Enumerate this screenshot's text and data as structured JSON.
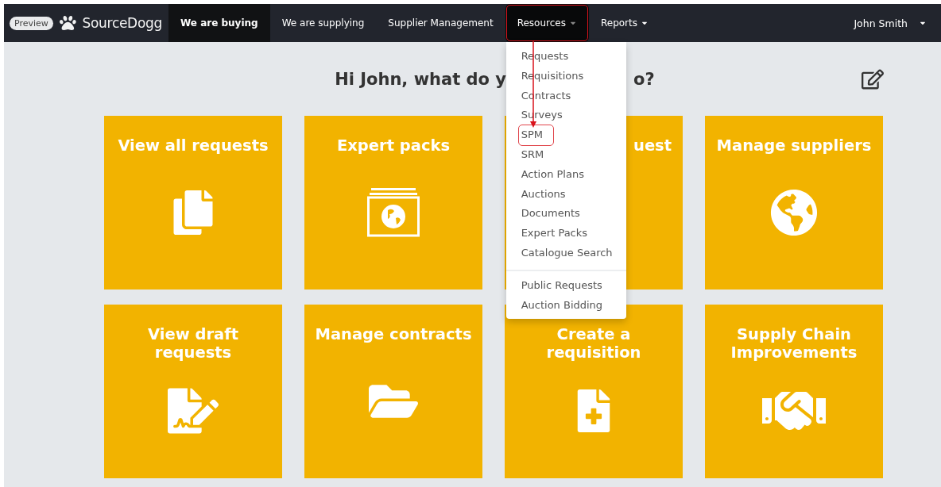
{
  "nav": {
    "badge": "Preview",
    "brand": "SourceDogg",
    "items": [
      {
        "label": "We are buying",
        "selected": true,
        "open": false,
        "dropdown": false,
        "annotated": false
      },
      {
        "label": "We are supplying",
        "selected": false,
        "open": false,
        "dropdown": false,
        "annotated": false
      },
      {
        "label": "Supplier Management",
        "selected": false,
        "open": false,
        "dropdown": false,
        "annotated": false
      },
      {
        "label": "Resources",
        "selected": false,
        "open": true,
        "dropdown": true,
        "annotated": true
      },
      {
        "label": "Reports",
        "selected": false,
        "open": false,
        "dropdown": true,
        "annotated": false
      }
    ],
    "user": "John Smith"
  },
  "dropdown": {
    "groups": [
      [
        {
          "label": "Requests",
          "annotated": false
        },
        {
          "label": "Requisitions",
          "annotated": false
        },
        {
          "label": "Contracts",
          "annotated": false
        },
        {
          "label": "Surveys",
          "annotated": false
        },
        {
          "label": "SPM",
          "annotated": true
        },
        {
          "label": "SRM",
          "annotated": false
        },
        {
          "label": "Action Plans",
          "annotated": false
        },
        {
          "label": "Auctions",
          "annotated": false
        },
        {
          "label": "Documents",
          "annotated": false
        },
        {
          "label": "Expert Packs",
          "annotated": false
        },
        {
          "label": "Catalogue Search",
          "annotated": false
        }
      ],
      [
        {
          "label": "Public Requests",
          "annotated": false
        },
        {
          "label": "Auction Bidding",
          "annotated": false
        }
      ]
    ]
  },
  "greeting": {
    "visible_start": "Hi John, what do y",
    "visible_end": "o?"
  },
  "tiles": [
    {
      "kind": "tile",
      "title": "View all requests"
    },
    {
      "kind": "tile",
      "title": "Expert packs"
    },
    {
      "kind": "covered",
      "title": "uest"
    },
    {
      "kind": "tile",
      "title": "Manage suppliers"
    },
    {
      "kind": "tile",
      "title": "View draft requests"
    },
    {
      "kind": "tile",
      "title": "Manage contracts"
    },
    {
      "kind": "tile",
      "title": "Create a requisition"
    },
    {
      "kind": "tile",
      "title": "Supply Chain Improvements"
    }
  ]
}
